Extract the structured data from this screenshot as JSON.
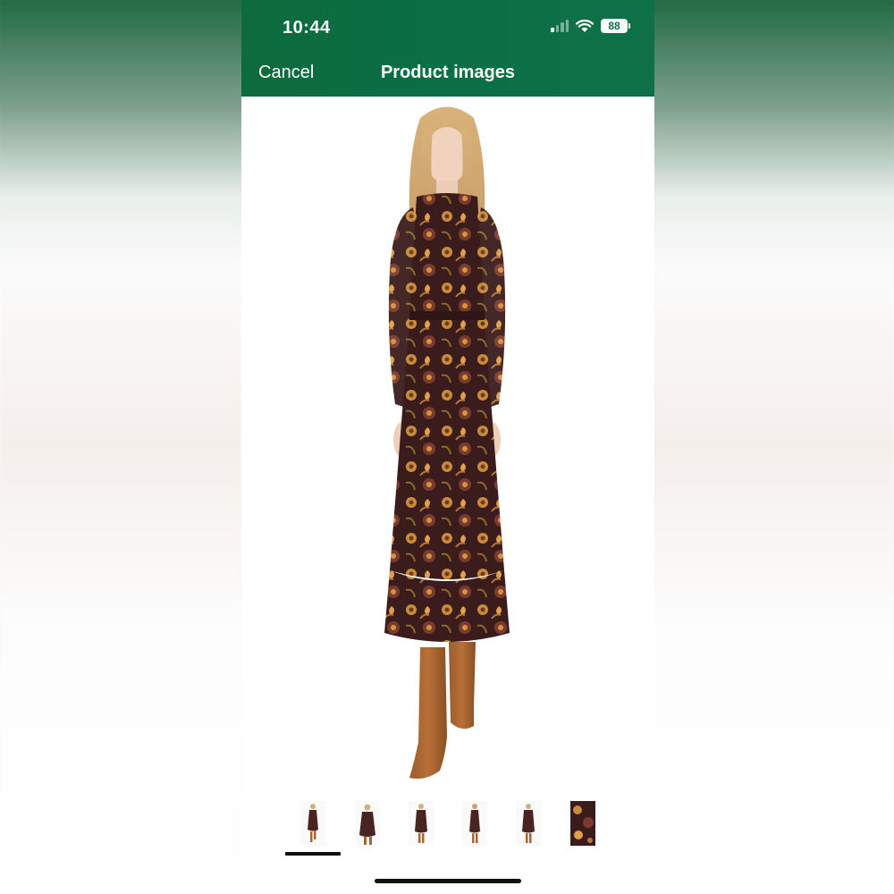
{
  "status_bar": {
    "time": "10:44",
    "battery": "88",
    "signal_icon": "cellular-signal-icon",
    "wifi_icon": "wifi-icon"
  },
  "header": {
    "cancel_label": "Cancel",
    "title": "Product images",
    "background_color": "#0a6f44"
  },
  "gallery": {
    "main_image": "model-in-floral-long-sleeve-midi-dress-and-tan-suede-boots",
    "selected_index": 0,
    "thumbnails": [
      {
        "name": "thumbnail-1",
        "view": "front-full"
      },
      {
        "name": "thumbnail-2",
        "view": "front-crop"
      },
      {
        "name": "thumbnail-3",
        "view": "side"
      },
      {
        "name": "thumbnail-4",
        "view": "back"
      },
      {
        "name": "thumbnail-5",
        "view": "front-hand"
      },
      {
        "name": "thumbnail-6",
        "view": "fabric-detail"
      }
    ]
  }
}
